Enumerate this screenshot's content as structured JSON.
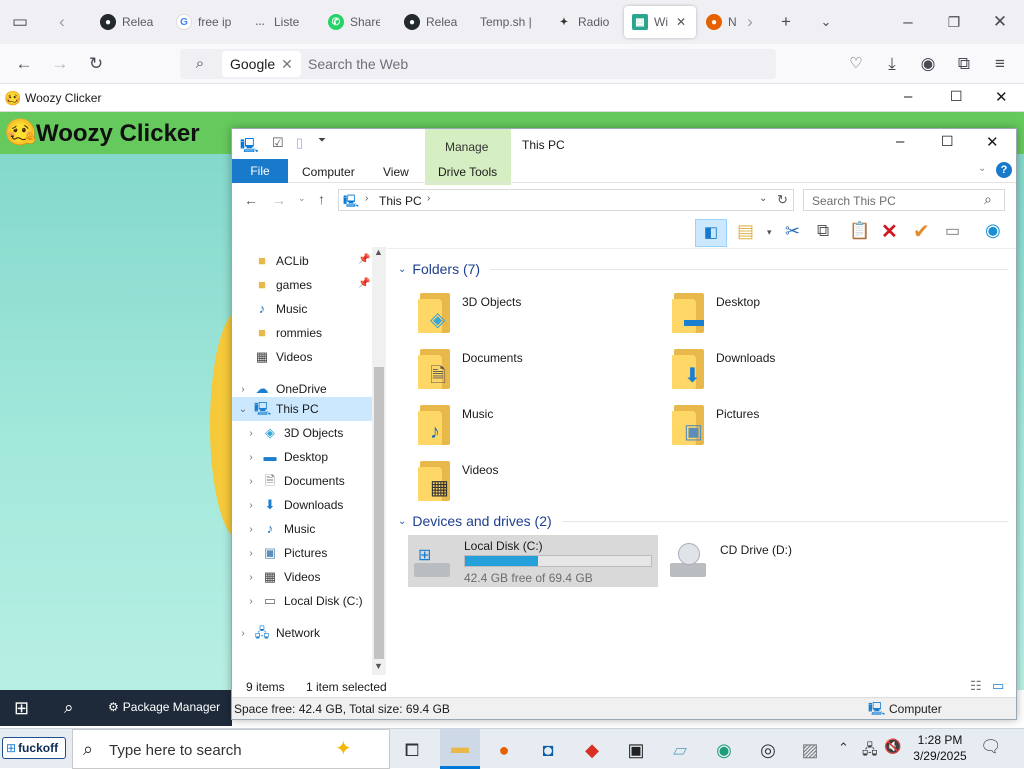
{
  "browser": {
    "tabs": [
      {
        "label": "Relea",
        "icon": "github-icon"
      },
      {
        "label": "free ip",
        "icon": "google-icon"
      },
      {
        "label": "Liste",
        "icon": "page-icon"
      },
      {
        "label": "Share",
        "icon": "whatsapp-icon"
      },
      {
        "label": "Relea",
        "icon": "github-icon"
      },
      {
        "label": "Temp.sh |",
        "icon": "blank-icon"
      },
      {
        "label": "Radio",
        "icon": "radio-icon"
      },
      {
        "label": "Wi",
        "icon": "app-icon"
      },
      {
        "label": "N",
        "icon": "firefox-icon"
      }
    ],
    "search_engine": "Google",
    "search_placeholder": "Search the Web"
  },
  "app": {
    "window_title": "Woozy Clicker",
    "header_title": "Woozy Clicker",
    "taskbar_button": "Package Manager"
  },
  "explorer": {
    "ribbon": {
      "context_label": "Manage",
      "title": "This PC",
      "tabs": [
        "File",
        "Computer",
        "View",
        "Drive Tools"
      ]
    },
    "address": "This PC",
    "search_placeholder": "Search This PC",
    "tree": {
      "quick": [
        {
          "label": "ACLib",
          "icon": "folder-icon",
          "pinned": true
        },
        {
          "label": "games",
          "icon": "folder-icon",
          "pinned": true
        },
        {
          "label": "Music",
          "icon": "music-icon",
          "pinned": false
        },
        {
          "label": "rommies",
          "icon": "folder-icon",
          "pinned": false
        },
        {
          "label": "Videos",
          "icon": "video-icon",
          "pinned": false
        }
      ],
      "onedrive": "OneDrive",
      "thispc": "This PC",
      "thispc_children": [
        {
          "label": "3D Objects",
          "icon": "cube-icon"
        },
        {
          "label": "Desktop",
          "icon": "desktop-icon"
        },
        {
          "label": "Documents",
          "icon": "document-icon"
        },
        {
          "label": "Downloads",
          "icon": "download-icon"
        },
        {
          "label": "Music",
          "icon": "music-icon"
        },
        {
          "label": "Pictures",
          "icon": "picture-icon"
        },
        {
          "label": "Videos",
          "icon": "video-icon"
        },
        {
          "label": "Local Disk (C:)",
          "icon": "disk-icon"
        }
      ],
      "network": "Network"
    },
    "folders_header": "Folders (7)",
    "folders": [
      {
        "label": "3D Objects",
        "icon": "cube-icon"
      },
      {
        "label": "Desktop",
        "icon": "desktop-icon"
      },
      {
        "label": "Documents",
        "icon": "document-icon"
      },
      {
        "label": "Downloads",
        "icon": "download-icon"
      },
      {
        "label": "Music",
        "icon": "music-icon"
      },
      {
        "label": "Pictures",
        "icon": "picture-icon"
      },
      {
        "label": "Videos",
        "icon": "video-icon"
      }
    ],
    "drives_header": "Devices and drives (2)",
    "drives": [
      {
        "label": "Local Disk (C:)",
        "free": "42.4 GB free of 69.4 GB",
        "used_fraction": 0.39
      },
      {
        "label": "CD Drive (D:)"
      }
    ],
    "status": {
      "items": "9 items",
      "selected": "1 item selected"
    },
    "bottom_status": {
      "space": "Space free: 42.4 GB, Total size: 69.4 GB",
      "location": "Computer"
    }
  },
  "taskbar": {
    "brand": "fuckoff",
    "search_placeholder": "Type here to search",
    "time": "1:28 PM",
    "date": "3/29/2025"
  },
  "colors": {
    "accent": "#0078d7",
    "manage_tab": "#d5eec2",
    "selected": "#cce8ff",
    "app_green": "#65c95d"
  }
}
